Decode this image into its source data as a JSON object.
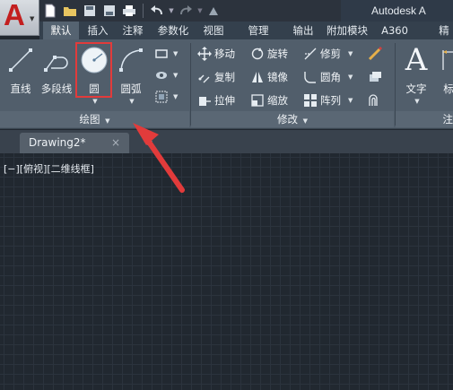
{
  "app": {
    "logo_letter": "A",
    "title": "Autodesk A"
  },
  "qat": {
    "icons": [
      "new-icon",
      "open-icon",
      "save-icon",
      "saveas-icon",
      "print-icon",
      "undo-icon",
      "redo-icon",
      "share-icon"
    ]
  },
  "tabs": [
    {
      "label": "默认",
      "active": true
    },
    {
      "label": "插入",
      "active": false
    },
    {
      "label": "注释",
      "active": false
    },
    {
      "label": "参数化",
      "active": false
    },
    {
      "label": "视图",
      "active": false
    },
    {
      "label": "管理",
      "active": false
    },
    {
      "label": "输出",
      "active": false
    },
    {
      "label": "附加模块",
      "active": false
    },
    {
      "label": "A360",
      "active": false
    },
    {
      "label": "精",
      "active": false
    }
  ],
  "draw_panel": {
    "title": "绘图",
    "tools": [
      {
        "label": "直线"
      },
      {
        "label": "多段线"
      },
      {
        "label": "圆"
      },
      {
        "label": "圆弧"
      }
    ]
  },
  "modify_panel": {
    "title": "修改",
    "tools": [
      {
        "label": "移动"
      },
      {
        "label": "旋转"
      },
      {
        "label": "修剪"
      },
      {
        "label": "复制"
      },
      {
        "label": "镜像"
      },
      {
        "label": "圆角"
      },
      {
        "label": "拉伸"
      },
      {
        "label": "缩放"
      },
      {
        "label": "阵列"
      }
    ]
  },
  "annotation_panel": {
    "tools": [
      {
        "label": "文字",
        "glyph": "A"
      },
      {
        "label": "标"
      }
    ],
    "title": "注"
  },
  "document": {
    "tab_label": "Drawing2*",
    "close": "×",
    "new_tab": "+"
  },
  "viewport": {
    "label": "[−][俯视][二维线框]"
  },
  "colors": {
    "highlight": "#e23b3b",
    "canvas": "#212830",
    "ribbon": "#515e6b"
  }
}
